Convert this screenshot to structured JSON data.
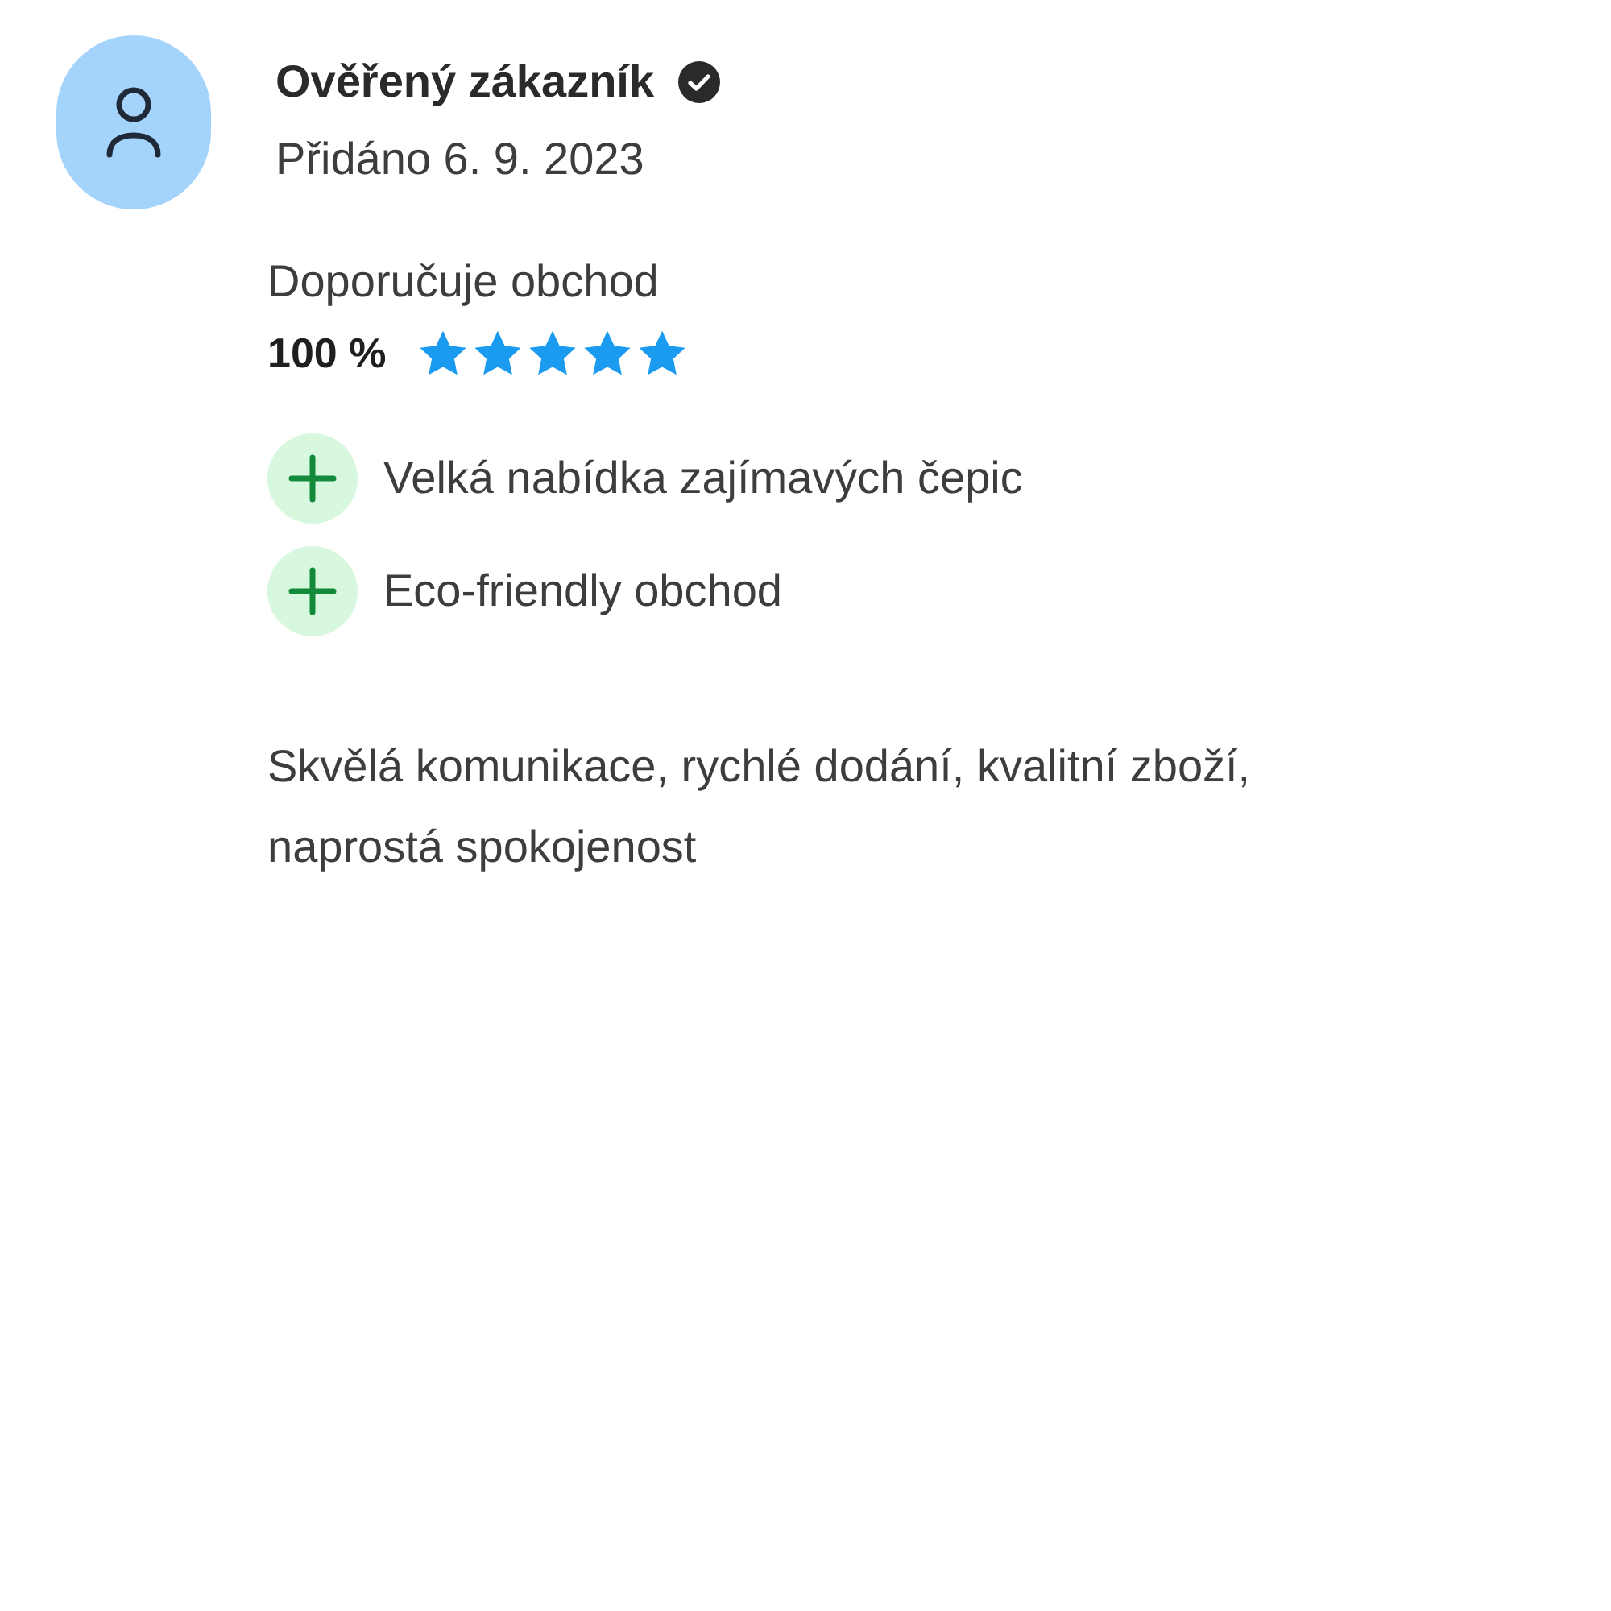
{
  "review": {
    "author": "Ověřený zákazník",
    "verified": true,
    "date": "Přidáno 6. 9. 2023",
    "recommend_label": "Doporučuje obchod",
    "recommend_value": "100 %",
    "stars": 5,
    "points": [
      {
        "kind": "plus",
        "text": "Velká nabídka zajímavých čepic"
      },
      {
        "kind": "plus",
        "text": "Eco-friendly obchod"
      }
    ],
    "text": "Skvělá komunikace, rychlé dodání, kvalitní zboží, naprostá spokojenost"
  }
}
